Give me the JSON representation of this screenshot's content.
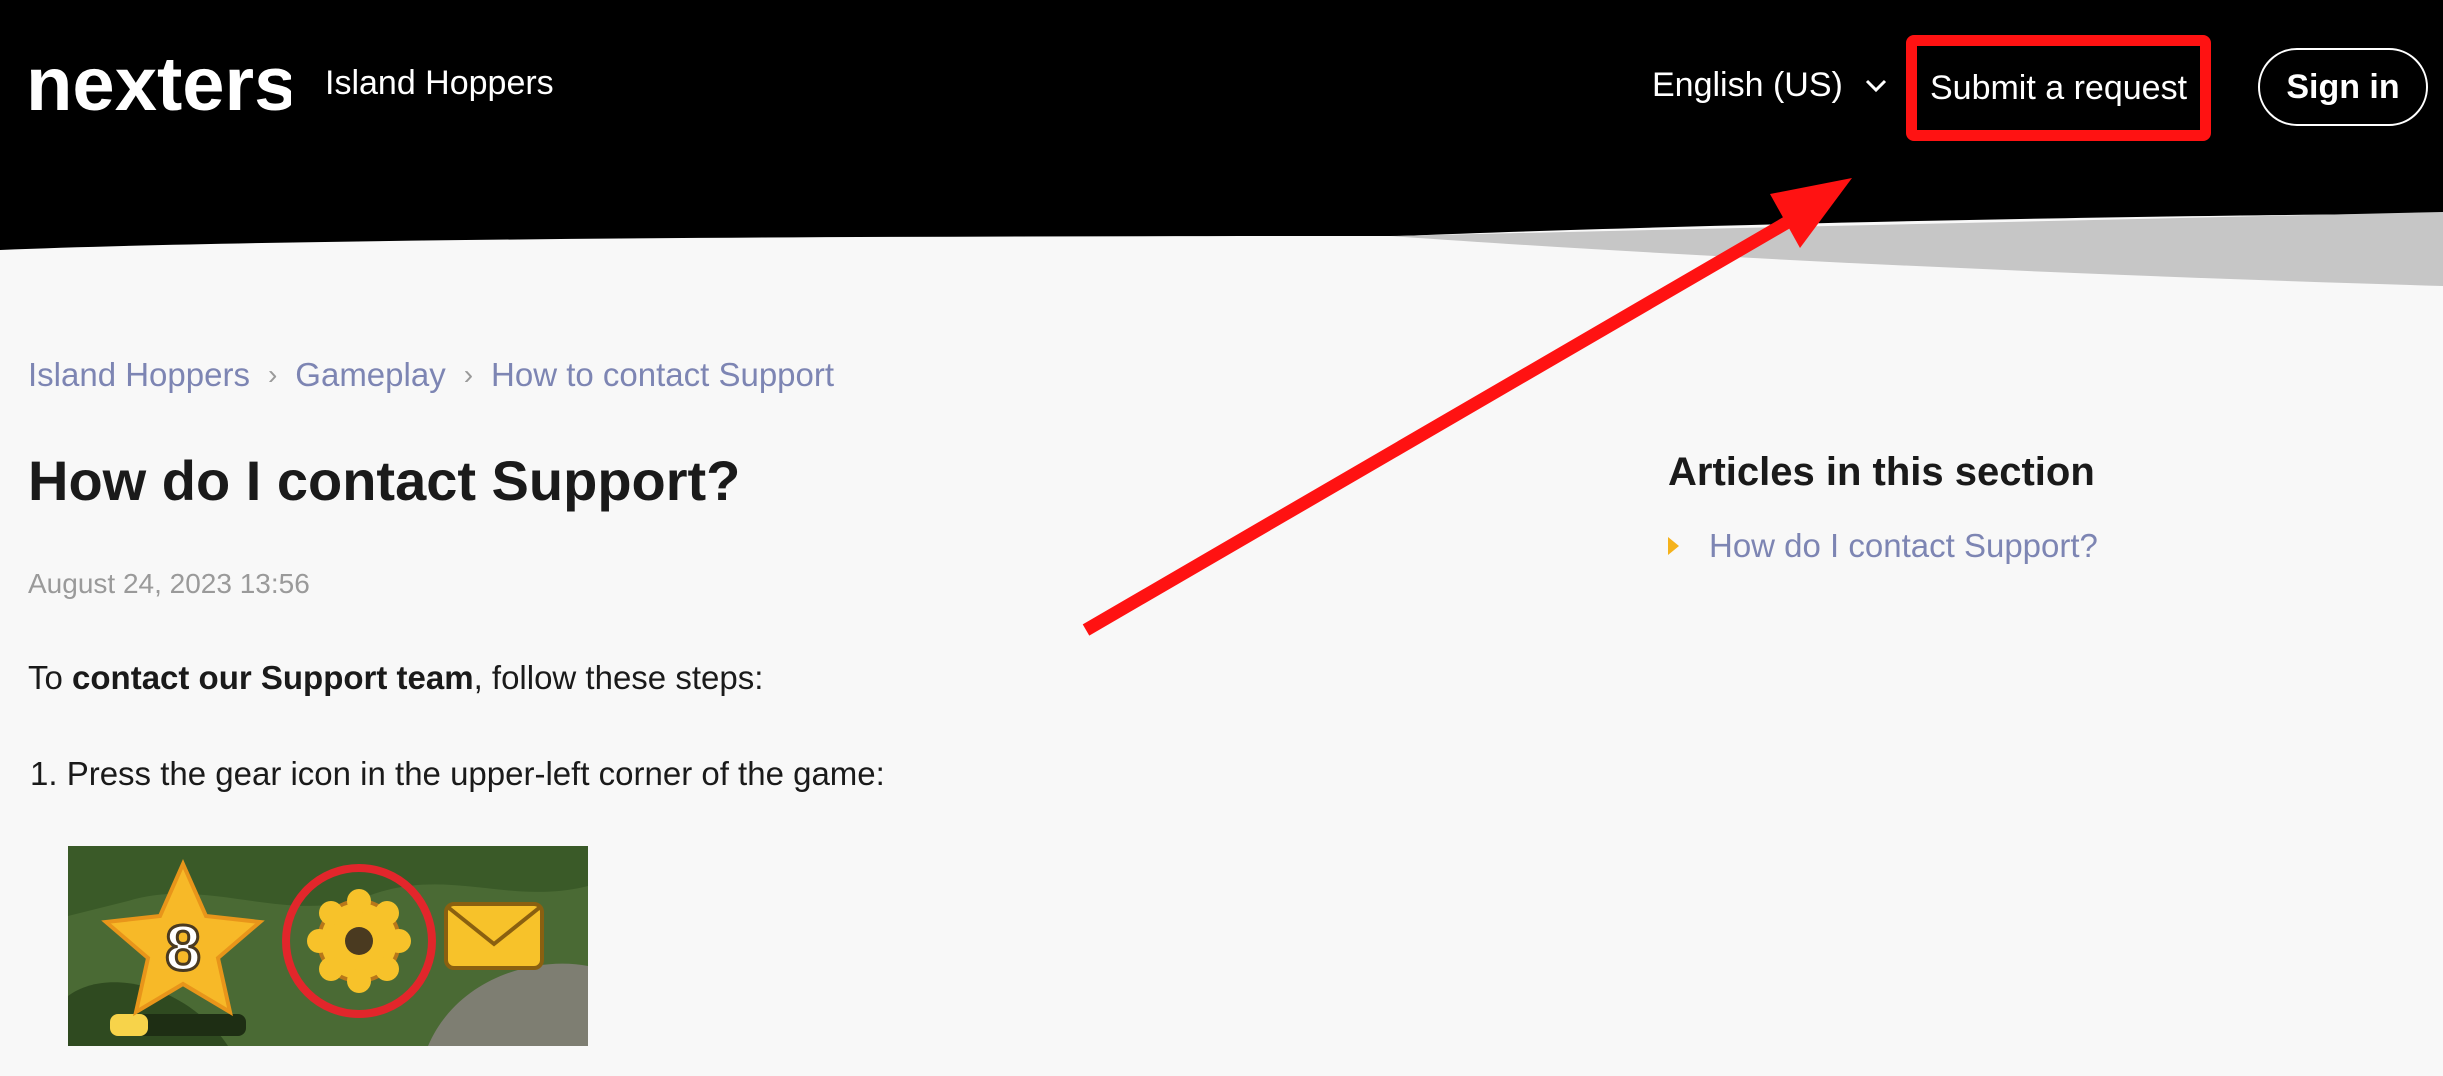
{
  "header": {
    "logo_text": "nexters",
    "brand_title": "Island Hoppers",
    "language": "English (US)",
    "submit_label": "Submit a request",
    "signin_label": "Sign in"
  },
  "breadcrumb": {
    "items": [
      "Island Hoppers",
      "Gameplay",
      "How to contact Support"
    ],
    "separator": "›"
  },
  "article": {
    "title": "How do I contact Support?",
    "date": "August 24, 2023 13:56",
    "intro_prefix": "To ",
    "intro_bold": "contact our Support team",
    "intro_suffix": ", follow these steps:",
    "steps": [
      "1. Press the gear icon in the upper-left corner of the game:"
    ],
    "screenshot": {
      "level_number": "8",
      "icons": [
        "star-icon",
        "gear-icon",
        "mail-icon"
      ]
    }
  },
  "sidebar": {
    "title": "Articles in this section",
    "items": [
      "How do I contact Support?"
    ]
  },
  "annotation": {
    "color": "#ff1212",
    "highlight": "Submit a request"
  },
  "colors": {
    "header_bg": "#000000",
    "link": "#7d85b3",
    "accent": "#f5b21b",
    "page_bg": "#f8f8f8"
  }
}
